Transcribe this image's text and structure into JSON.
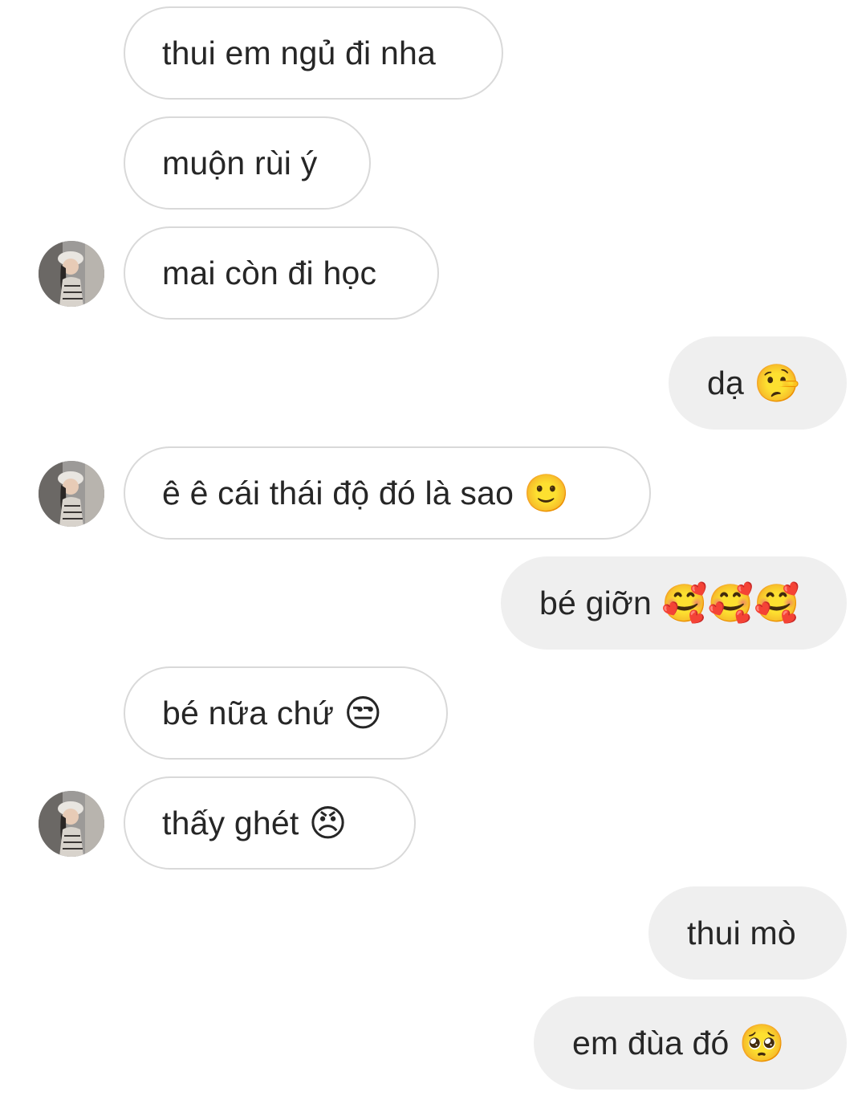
{
  "conversation": {
    "messages": [
      {
        "side": "in",
        "text": "thui em ngủ đi nha",
        "emoji": ""
      },
      {
        "side": "in",
        "text": "muộn rùi ý",
        "emoji": ""
      },
      {
        "side": "in",
        "text": "mai còn đi học",
        "emoji": ""
      },
      {
        "side": "out",
        "text": "dạ",
        "emoji": "🤥"
      },
      {
        "side": "in",
        "text": "ê ê cái thái độ đó là sao",
        "emoji": "🙂"
      },
      {
        "side": "out",
        "text": "bé giỡn",
        "emoji": "🥰🥰🥰"
      },
      {
        "side": "in",
        "text": "bé nữa chứ",
        "emoji": "😒"
      },
      {
        "side": "in",
        "text": "thấy ghét",
        "emoji": "😠"
      },
      {
        "side": "out",
        "text": "thui mò",
        "emoji": ""
      },
      {
        "side": "out",
        "text": "em đùa đó",
        "emoji": "🥺"
      }
    ]
  },
  "avatar_icon": "profile-photo-avatar",
  "colors": {
    "incoming_bubble_bg": "#ffffff",
    "incoming_bubble_border": "#d9d9d9",
    "outgoing_bubble_bg": "#efefef",
    "text": "#262626"
  }
}
